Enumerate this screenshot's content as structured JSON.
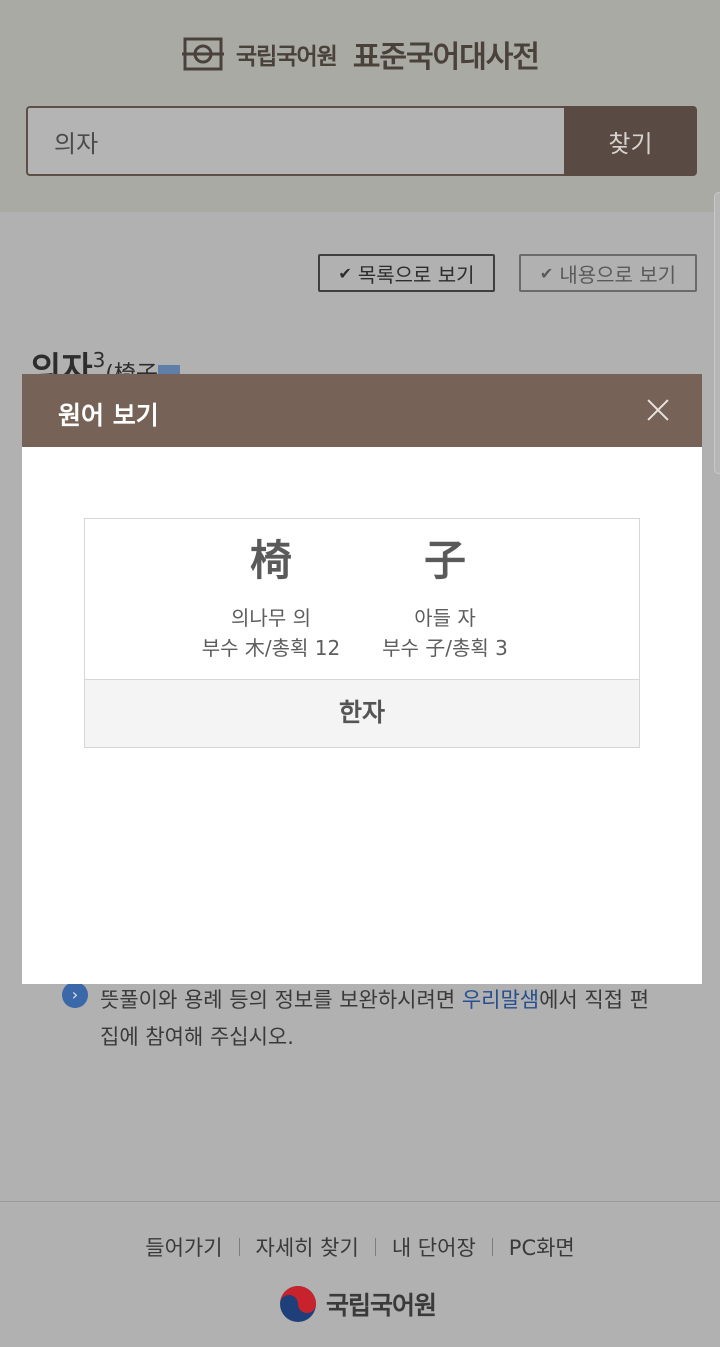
{
  "header": {
    "org_name": "국립국어원",
    "dict_name": "표준국어대사전"
  },
  "search": {
    "value": "의자",
    "button_label": "찾기"
  },
  "view_toggle": {
    "list_label": "목록으로 보기",
    "content_label": "내용으로 보기"
  },
  "entry": {
    "headword": "의자",
    "homograph_number": "3",
    "origin_partial": "(椅子"
  },
  "modal": {
    "title": "원어 보기",
    "characters": [
      {
        "glyph": "椅",
        "reading": "의나무 의",
        "radical": "부수 木/총획 12"
      },
      {
        "glyph": "子",
        "reading": "아들 자",
        "radical": "부수 子/총획 3"
      }
    ],
    "type_label": "한자"
  },
  "notice": {
    "icon": "chevron-right-icon",
    "text_before": "뜻풀이와 용례 등의 정보를 보완하시려면 ",
    "link_text": "우리말샘",
    "text_after": "에서 직접 편집에 참여해 주십시오."
  },
  "footer": {
    "links": [
      "들어가기",
      "자세히 찾기",
      "내 단어장",
      "PC화면"
    ],
    "org_name": "국립국어원"
  },
  "colors": {
    "brand_brown": "#594b43",
    "modal_header": "#776257",
    "link_blue": "#274f8f"
  }
}
